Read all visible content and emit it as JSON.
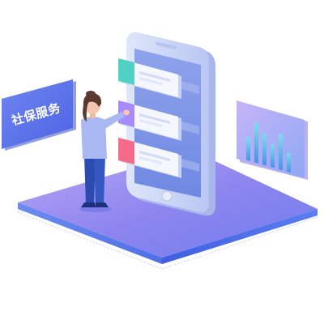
{
  "scene": {
    "sign": {
      "label": "社保服务"
    },
    "chart_panel": {
      "bar_levels": [
        0.55,
        0.95,
        0.75,
        0.55,
        0.85,
        0.45
      ]
    },
    "phone": {
      "cards": [
        {
          "accent_color": "#4fd1c5",
          "accent_icon": "square-tile-icon"
        },
        {
          "accent_color": "#a78bfa",
          "accent_icon": "square-tile-icon"
        },
        {
          "accent_color": "#f76b8a",
          "accent_icon": "square-tile-icon"
        }
      ]
    },
    "colors": {
      "platform_top": "#8d7ef0",
      "platform_edge": "#5b6ee8",
      "phone_frame": "#c7d2f5",
      "phone_screen": "#7f97e6",
      "sign_bg": "#5b6ee8",
      "chart_bg": "#b9a6f5",
      "person_shirt": "#aab8f2",
      "person_pants": "#2c4bb0",
      "person_hair": "#5a3a2e"
    }
  }
}
